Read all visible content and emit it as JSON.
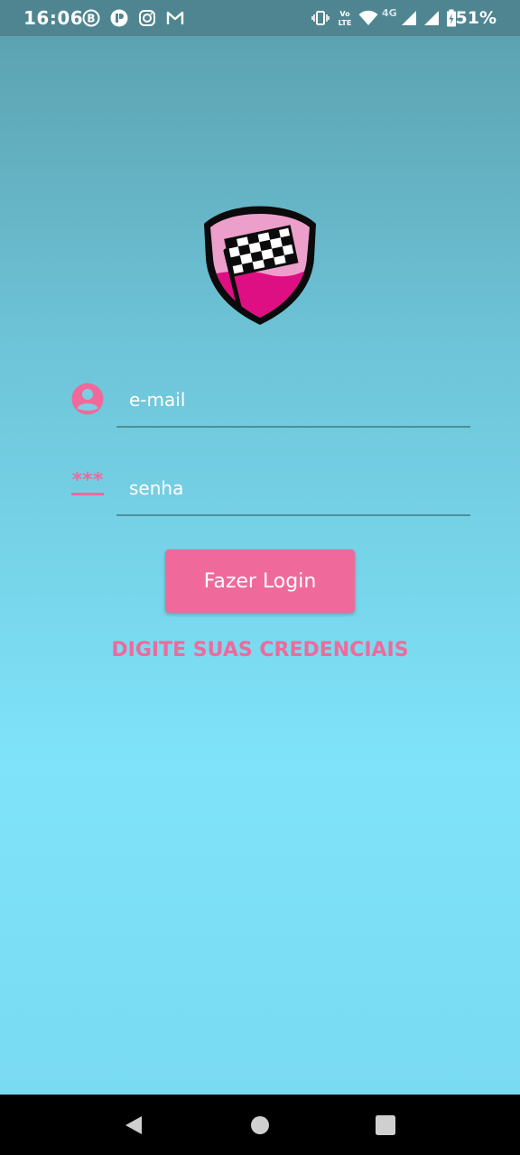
{
  "status_bar": {
    "time": "16:06",
    "battery_percent": "51%",
    "network_label": "4G",
    "volte_label": "Vo LTE",
    "left_icons": [
      "b-circle-icon",
      "pause-circle-icon",
      "instagram-icon",
      "gmail-icon"
    ],
    "right_icons": [
      "vibrate-icon",
      "volte-icon",
      "wifi-icon",
      "signal-icon",
      "signal-icon",
      "battery-icon"
    ]
  },
  "login": {
    "email_placeholder": "e-mail",
    "password_placeholder": "senha",
    "button_label": "Fazer Login",
    "message": "DIGITE SUAS CREDENCIAIS"
  },
  "colors": {
    "accent": "#ef6a9b",
    "status_bar": "#4e8591",
    "background_top": "#5a9fad",
    "background_bottom": "#7fe3f9"
  },
  "nav_bar": {
    "buttons": [
      "back-icon",
      "home-icon",
      "recents-icon"
    ]
  }
}
